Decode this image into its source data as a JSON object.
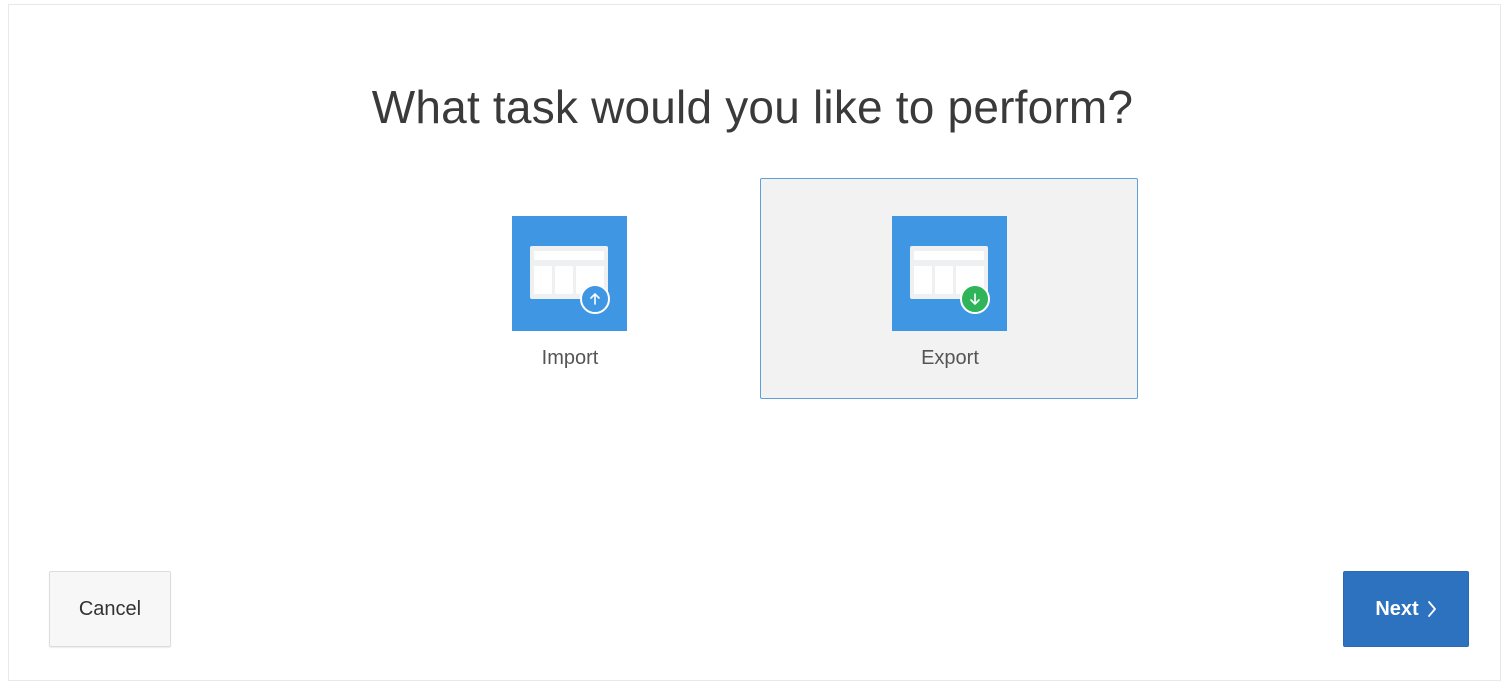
{
  "dialog": {
    "title": "What task would you like to perform?"
  },
  "options": [
    {
      "label": "Import",
      "icon": "upload-icon",
      "selected": false
    },
    {
      "label": "Export",
      "icon": "download-icon",
      "selected": true
    }
  ],
  "footer": {
    "cancel_label": "Cancel",
    "next_label": "Next"
  },
  "colors": {
    "tile_blue": "#3f97e4",
    "download_green": "#2fb45a",
    "selected_border": "#5d9fd8",
    "primary_button": "#2d72be"
  }
}
